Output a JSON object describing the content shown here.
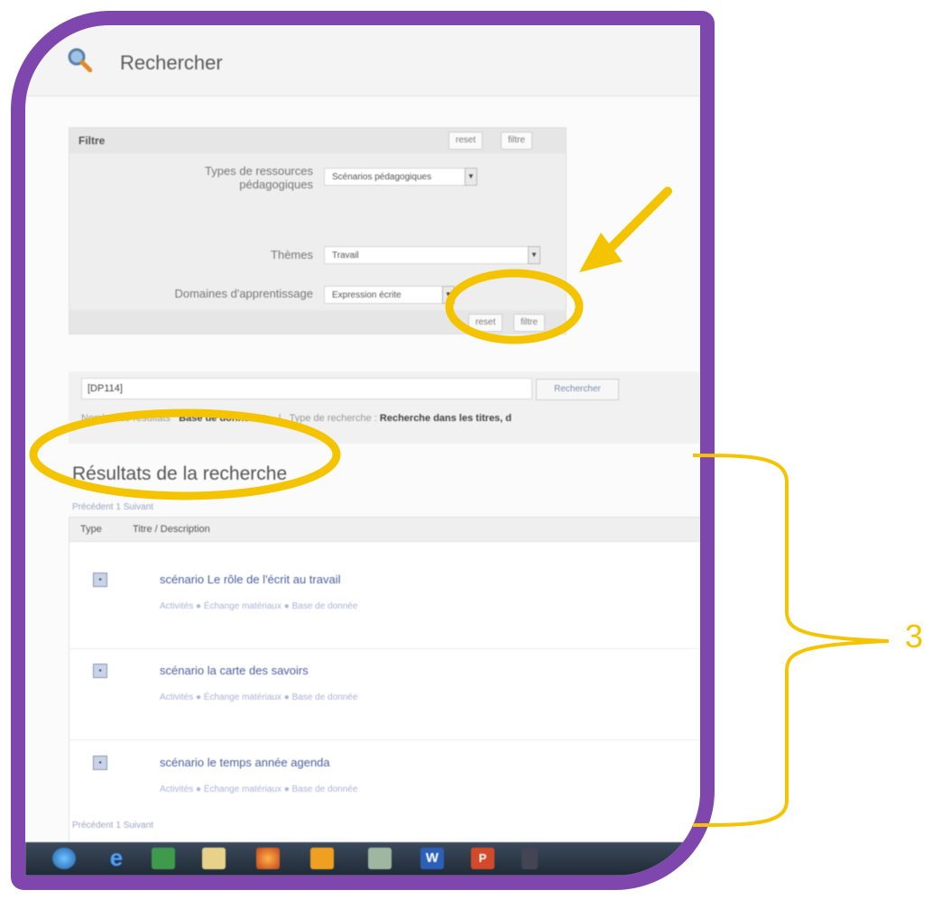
{
  "header": {
    "title": "Rechercher"
  },
  "filter_panel": {
    "title": "Filtre",
    "reset_label": "reset",
    "filter_label": "filtre",
    "rows": [
      {
        "label_line1": "Types de ressources",
        "label_line2": "pédagogiques",
        "value": "Scénarios pédagogiques"
      },
      {
        "label_line1": "Thèmes",
        "label_line2": "",
        "value": "Travail"
      },
      {
        "label_line1": "Domaines d'apprentissage",
        "label_line2": "",
        "value": "Expression écrite"
      }
    ]
  },
  "search": {
    "query": "[DP114]",
    "button_label": "Rechercher",
    "options_prefix": "Nombre de résultats",
    "options_value": "Base de donnée ▼",
    "type_label": "Type de recherche :",
    "type_value": "Recherche dans les titres, d"
  },
  "results": {
    "title": "Résultats de la recherche",
    "pager_top": "Précédent 1 Suivant",
    "pager_bottom": "Précédent 1 Suivant",
    "col_type": "Type",
    "col_title": "Titre / Description",
    "items": [
      {
        "title": "scénario Le rôle de l'écrit au travail",
        "tags": "Activités ● Échange matériaux ● Base de donnée"
      },
      {
        "title": "scénario la carte des savoirs",
        "tags": "Activités ● Échange matériaux ● Base de donnée"
      },
      {
        "title": "scénario le temps année agenda",
        "tags": "Activités ● Échange matériaux ● Base de donnée"
      }
    ]
  },
  "annotation": {
    "number": "3"
  },
  "colors": {
    "frame": "#7f47ad",
    "highlight": "#f5c400",
    "link": "#4a5f9e"
  },
  "taskbar_icons": [
    "windows-start-icon",
    "internet-explorer-icon",
    "spreadsheet-icon",
    "folder-icon",
    "firefox-icon",
    "outlook-icon",
    "network-icon",
    "word-icon",
    "powerpoint-icon"
  ]
}
